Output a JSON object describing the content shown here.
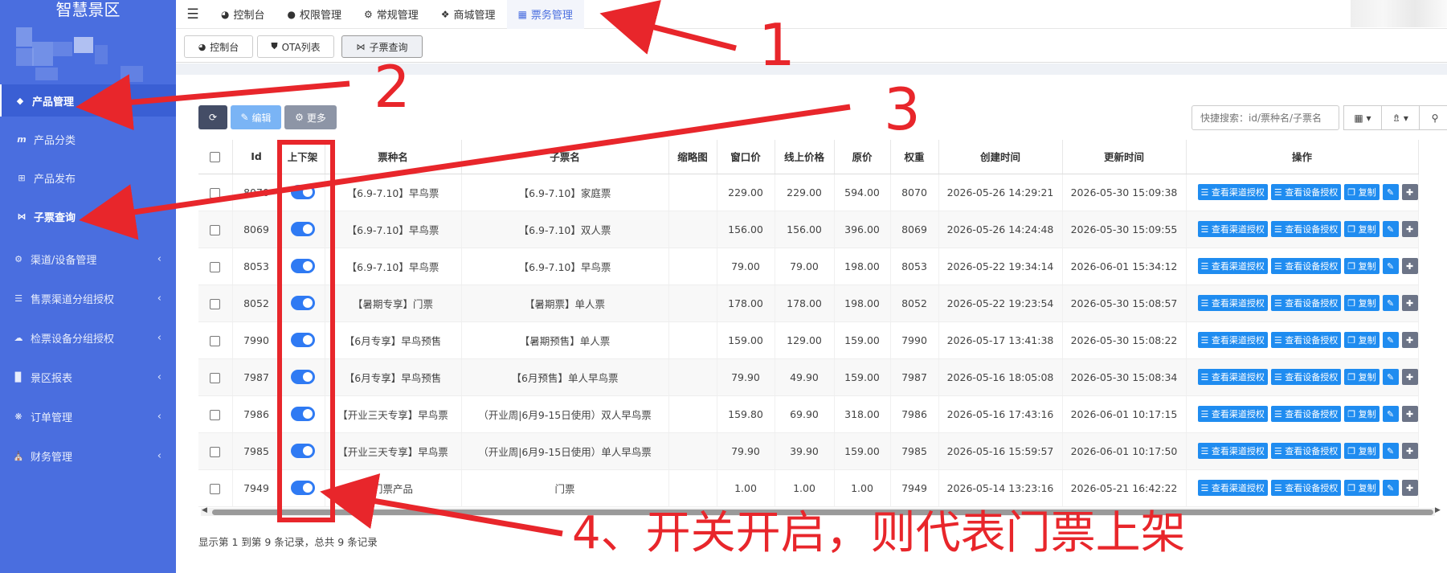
{
  "app": {
    "title": "智慧景区"
  },
  "sidebar": {
    "items": [
      {
        "label": "产品管理",
        "icon": "tag-icon"
      },
      {
        "label": "产品分类",
        "icon": "m-icon"
      },
      {
        "label": "产品发布",
        "icon": "plus-square-icon"
      },
      {
        "label": "子票查询",
        "icon": "ticket-icon"
      },
      {
        "label": "渠道/设备管理",
        "icon": "cogs-icon"
      },
      {
        "label": "售票渠道分组授权",
        "icon": "database-icon"
      },
      {
        "label": "检票设备分组授权",
        "icon": "cloud-icon"
      },
      {
        "label": "景区报表",
        "icon": "bar-chart-icon"
      },
      {
        "label": "订单管理",
        "icon": "puzzle-icon"
      },
      {
        "label": "财务管理",
        "icon": "bank-icon"
      }
    ]
  },
  "topnav": {
    "tabs": [
      "控制台",
      "权限管理",
      "常规管理",
      "商城管理",
      "票务管理"
    ]
  },
  "subtabs": [
    "控制台",
    "OTA列表",
    "子票查询"
  ],
  "toolbar": {
    "edit": "编辑",
    "more": "更多",
    "search_placeholder": "快捷搜索：id/票种名/子票名"
  },
  "table": {
    "headers": [
      "Id",
      "上下架",
      "票种名",
      "子票名",
      "缩略图",
      "窗口价",
      "线上价格",
      "原价",
      "权重",
      "创建时间",
      "更新时间",
      "操作"
    ],
    "rows": [
      {
        "id": "8070",
        "type": "【6.9-7.10】早鸟票",
        "sub": "【6.9-7.10】家庭票",
        "win": "229.00",
        "online": "229.00",
        "orig": "594.00",
        "weight": "8070",
        "created": "2026-05-26 14:29:21",
        "updated": "2026-05-30 15:09:38"
      },
      {
        "id": "8069",
        "type": "【6.9-7.10】早鸟票",
        "sub": "【6.9-7.10】双人票",
        "win": "156.00",
        "online": "156.00",
        "orig": "396.00",
        "weight": "8069",
        "created": "2026-05-26 14:24:48",
        "updated": "2026-05-30 15:09:55"
      },
      {
        "id": "8053",
        "type": "【6.9-7.10】早鸟票",
        "sub": "【6.9-7.10】早鸟票",
        "win": "79.00",
        "online": "79.00",
        "orig": "198.00",
        "weight": "8053",
        "created": "2026-05-22 19:34:14",
        "updated": "2026-06-01 15:34:12"
      },
      {
        "id": "8052",
        "type": "【暑期专享】门票",
        "sub": "【暑期票】单人票",
        "win": "178.00",
        "online": "178.00",
        "orig": "198.00",
        "weight": "8052",
        "created": "2026-05-22 19:23:54",
        "updated": "2026-05-30 15:08:57"
      },
      {
        "id": "7990",
        "type": "【6月专享】早鸟预售",
        "sub": "【暑期预售】单人票",
        "win": "159.00",
        "online": "129.00",
        "orig": "159.00",
        "weight": "7990",
        "created": "2026-05-17 13:41:38",
        "updated": "2026-05-30 15:08:22"
      },
      {
        "id": "7987",
        "type": "【6月专享】早鸟预售",
        "sub": "【6月预售】单人早鸟票",
        "win": "79.90",
        "online": "49.90",
        "orig": "159.00",
        "weight": "7987",
        "created": "2026-05-16 18:05:08",
        "updated": "2026-05-30 15:08:34"
      },
      {
        "id": "7986",
        "type": "【开业三天专享】早鸟票",
        "sub": "（开业周|6月9-15日使用）双人早鸟票",
        "win": "159.80",
        "online": "69.90",
        "orig": "318.00",
        "weight": "7986",
        "created": "2026-05-16 17:43:16",
        "updated": "2026-06-01 10:17:15"
      },
      {
        "id": "7985",
        "type": "【开业三天专享】早鸟票",
        "sub": "（开业周|6月9-15日使用）单人早鸟票",
        "win": "79.90",
        "online": "39.90",
        "orig": "159.00",
        "weight": "7985",
        "created": "2026-05-16 15:59:57",
        "updated": "2026-06-01 10:17:50"
      },
      {
        "id": "7949",
        "type": "门票产品",
        "sub": "门票",
        "win": "1.00",
        "online": "1.00",
        "orig": "1.00",
        "weight": "7949",
        "created": "2026-05-14 13:23:16",
        "updated": "2026-05-21 16:42:22"
      }
    ],
    "ops": {
      "channel": "查看渠道授权",
      "device": "查看设备授权",
      "copy": "复制"
    }
  },
  "footer": "显示第 1 到第 9 条记录，总共 9 条记录",
  "annotations": {
    "n1": "1",
    "n2": "2",
    "n3": "3",
    "text4": "4、开关开启，则代表门票上架"
  },
  "colors": {
    "sidebar": "#4a6edf",
    "accent": "#2f7af3",
    "annotation": "#e8262b"
  }
}
